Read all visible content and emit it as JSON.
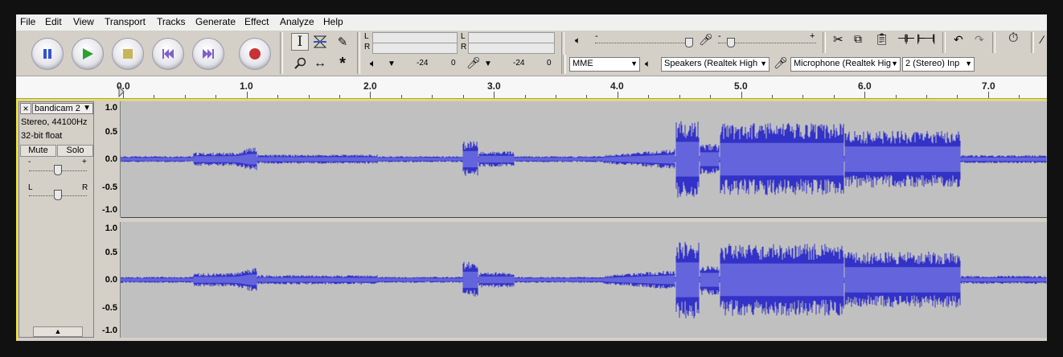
{
  "menu": [
    "File",
    "Edit",
    "View",
    "Transport",
    "Tracks",
    "Generate",
    "Effect",
    "Analyze",
    "Help"
  ],
  "meters": {
    "play_l": "L",
    "play_r": "R",
    "rec_l": "L",
    "rec_r": "R",
    "play_scale": [
      "-24",
      "0"
    ],
    "rec_scale": [
      "-24",
      "0"
    ]
  },
  "mixer": {
    "minus": "-",
    "plus": "+"
  },
  "devices": {
    "host": "MME",
    "output": "Speakers (Realtek High",
    "input": "Microphone (Realtek Hig",
    "channels": "2 (Stereo) Inp"
  },
  "ruler": {
    "labels": [
      "0.0",
      "1.0",
      "2.0",
      "3.0",
      "4.0",
      "5.0",
      "6.0",
      "7.0"
    ]
  },
  "track": {
    "close": "×",
    "name": "bandicam 2",
    "format": "Stereo, 44100Hz",
    "bits": "32-bit float",
    "mute": "Mute",
    "solo": "Solo",
    "gain_minus": "-",
    "gain_plus": "+",
    "pan_left": "L",
    "pan_right": "R"
  },
  "vscale": [
    "1.0",
    "0.5",
    "0.0",
    "-0.5",
    "-1.0"
  ],
  "colors": {
    "waveform": "#3232c8",
    "waveform_light": "#6464dc",
    "track_bg": "#c0c0c0",
    "selection_border": "#f0e52e"
  }
}
